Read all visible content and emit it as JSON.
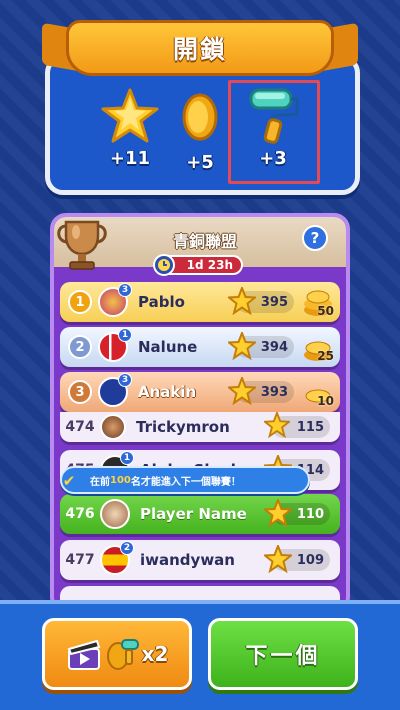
{
  "unlock": {
    "title": "開鎖",
    "rewards": [
      {
        "icon": "star-icon",
        "amount": "+11"
      },
      {
        "icon": "coin-icon",
        "amount": "+5"
      },
      {
        "icon": "paint-roller-icon",
        "amount": "+3"
      }
    ]
  },
  "league": {
    "title": "青銅聯盟",
    "help": "?",
    "timer": "1d 23h",
    "rows": [
      {
        "rank": "1",
        "name": "Pablo",
        "level": "3",
        "score": "395",
        "coins": "50"
      },
      {
        "rank": "2",
        "name": "Nalune",
        "level": "1",
        "score": "394",
        "coins": "25"
      },
      {
        "rank": "3",
        "name": "Anakin",
        "level": "3",
        "score": "393",
        "coins": "10"
      },
      {
        "rank": "474",
        "name": "Trickymron",
        "level": "",
        "score": "115",
        "coins": ""
      },
      {
        "rank": "475",
        "name": "Alpha Shad",
        "level": "1",
        "score": "114",
        "coins": ""
      },
      {
        "rank": "476",
        "name": "Player Name",
        "level": "",
        "score": "110",
        "coins": ""
      },
      {
        "rank": "477",
        "name": "iwandywan",
        "level": "2",
        "score": "109",
        "coins": ""
      }
    ],
    "tooltip_prefix": "在前",
    "tooltip_number": "100",
    "tooltip_suffix": "名才能進入下一個聯賽！"
  },
  "buttons": {
    "video_multiplier": "x2",
    "next_label": "下一個"
  },
  "colors": {
    "background": "#1d3d8f",
    "panel_blue": "#1c58c9",
    "ribbon_orange": "#f29a16",
    "league_purple": "#7a39c8",
    "player_green": "#46b21f",
    "highlight_red": "#e24a55"
  }
}
